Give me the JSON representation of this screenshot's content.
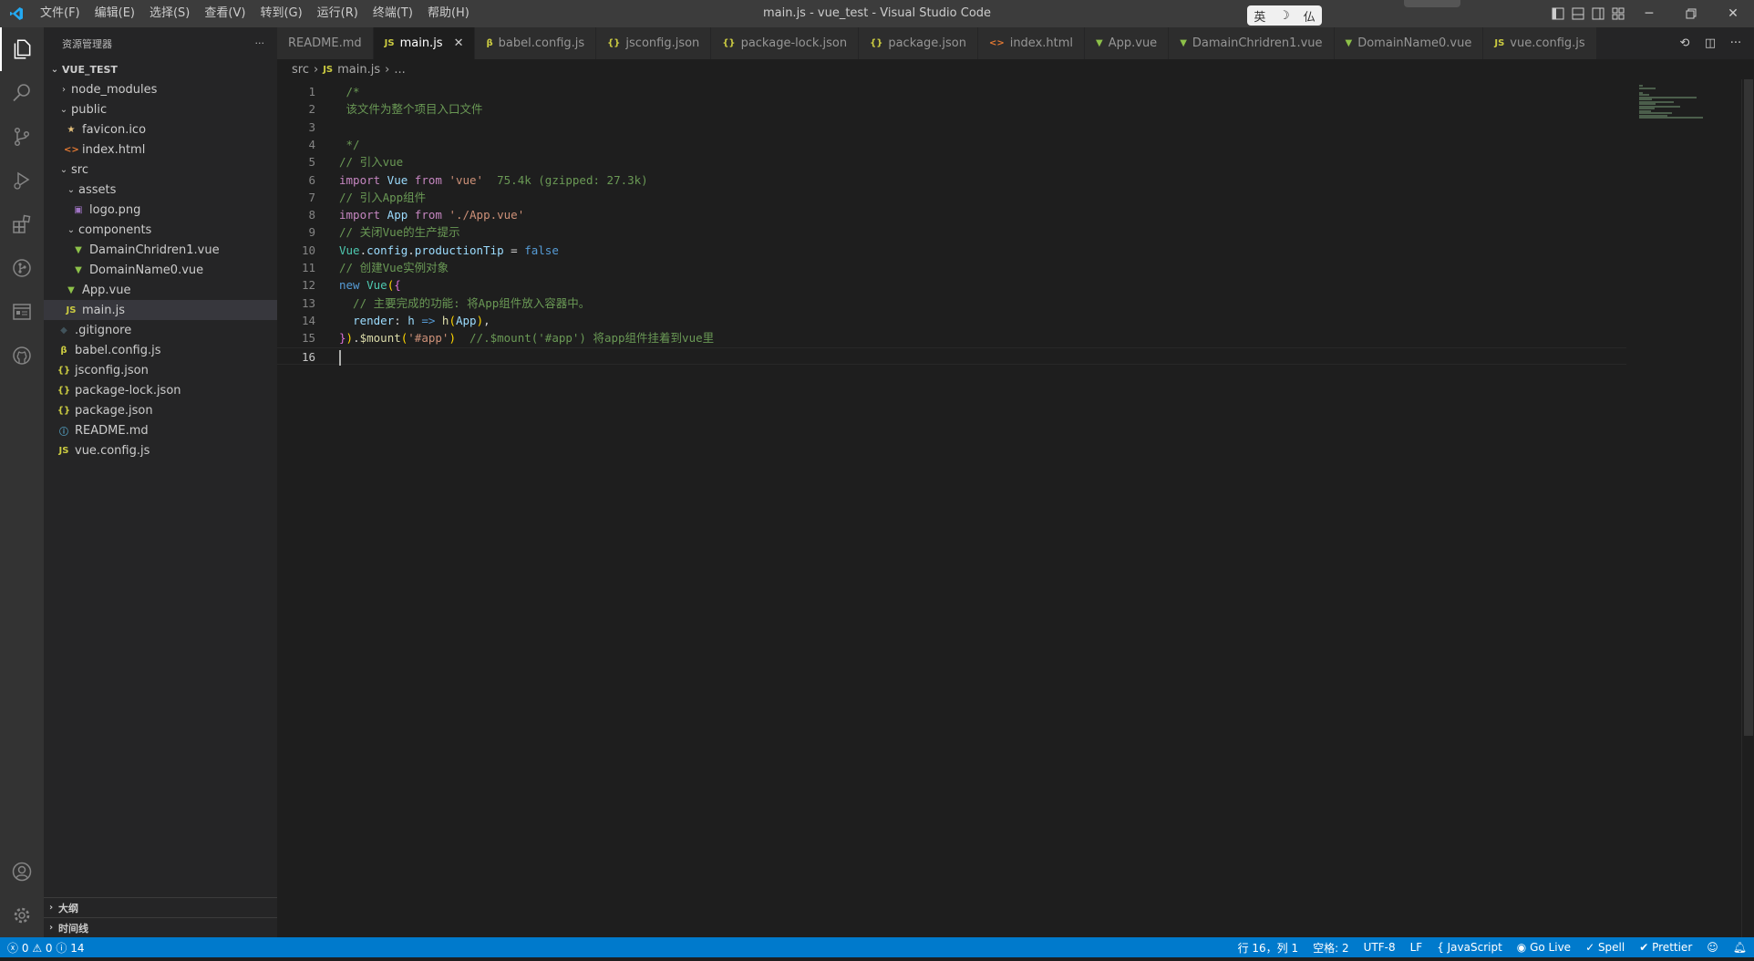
{
  "window": {
    "title": "main.js - vue_test - Visual Studio Code",
    "menu": [
      "文件(F)",
      "编辑(E)",
      "选择(S)",
      "查看(V)",
      "转到(G)",
      "运行(R)",
      "终端(T)",
      "帮助(H)"
    ],
    "ime": [
      "英",
      "☽",
      "仏"
    ]
  },
  "sidebar": {
    "title": "资源管理器",
    "more": "···",
    "root": "VUE_TEST",
    "items": [
      {
        "label": "node_modules",
        "depth": 1,
        "kind": "folder",
        "open": false
      },
      {
        "label": "public",
        "depth": 1,
        "kind": "folder",
        "open": true
      },
      {
        "label": "favicon.ico",
        "depth": 2,
        "kind": "star"
      },
      {
        "label": "index.html",
        "depth": 2,
        "kind": "html"
      },
      {
        "label": "src",
        "depth": 1,
        "kind": "folder",
        "open": true
      },
      {
        "label": "assets",
        "depth": 2,
        "kind": "folder",
        "open": true
      },
      {
        "label": "logo.png",
        "depth": 3,
        "kind": "image"
      },
      {
        "label": "components",
        "depth": 2,
        "kind": "folder",
        "open": true
      },
      {
        "label": "DamainChridren1.vue",
        "depth": 3,
        "kind": "vue"
      },
      {
        "label": "DomainName0.vue",
        "depth": 3,
        "kind": "vue"
      },
      {
        "label": "App.vue",
        "depth": 2,
        "kind": "vue"
      },
      {
        "label": "main.js",
        "depth": 2,
        "kind": "js",
        "selected": true
      },
      {
        "label": ".gitignore",
        "depth": 1,
        "kind": "git"
      },
      {
        "label": "babel.config.js",
        "depth": 1,
        "kind": "babel"
      },
      {
        "label": "jsconfig.json",
        "depth": 1,
        "kind": "json"
      },
      {
        "label": "package-lock.json",
        "depth": 1,
        "kind": "json"
      },
      {
        "label": "package.json",
        "depth": 1,
        "kind": "json"
      },
      {
        "label": "README.md",
        "depth": 1,
        "kind": "info"
      },
      {
        "label": "vue.config.js",
        "depth": 1,
        "kind": "js"
      }
    ],
    "outline": "大纲",
    "timeline": "时间线"
  },
  "tabs": [
    {
      "label": "README.md",
      "icon": "",
      "active": false
    },
    {
      "label": "main.js",
      "icon": "JS",
      "active": true
    },
    {
      "label": "babel.config.js",
      "icon": "babel",
      "active": false
    },
    {
      "label": "jsconfig.json",
      "icon": "{}",
      "active": false
    },
    {
      "label": "package-lock.json",
      "icon": "{}",
      "active": false
    },
    {
      "label": "package.json",
      "icon": "{}",
      "active": false
    },
    {
      "label": "index.html",
      "icon": "<>",
      "active": false
    },
    {
      "label": "App.vue",
      "icon": "vue",
      "active": false
    },
    {
      "label": "DamainChridren1.vue",
      "icon": "vue",
      "active": false
    },
    {
      "label": "DomainName0.vue",
      "icon": "vue",
      "active": false
    },
    {
      "label": "vue.config.js",
      "icon": "JS",
      "active": false
    }
  ],
  "breadcrumb": {
    "folder": "src",
    "file": "main.js",
    "tail": "..."
  },
  "editor": {
    "current_line": 16,
    "lines": [
      [
        {
          "t": " /*",
          "c": "c-comment"
        }
      ],
      [
        {
          "t": " 该文件为整个项目入口文件",
          "c": "c-comment"
        }
      ],
      [
        {
          "t": "",
          "c": ""
        }
      ],
      [
        {
          "t": " */",
          "c": "c-comment"
        }
      ],
      [
        {
          "t": "// 引入vue",
          "c": "c-comment"
        }
      ],
      [
        {
          "t": "import",
          "c": "c-kw"
        },
        {
          "t": " Vue ",
          "c": "c-var"
        },
        {
          "t": "from",
          "c": "c-kw"
        },
        {
          "t": " ",
          "c": ""
        },
        {
          "t": "'vue'",
          "c": "c-str"
        },
        {
          "t": "  75.4k (gzipped: 27.3k)",
          "c": "c-hint"
        }
      ],
      [
        {
          "t": "// 引入App组件",
          "c": "c-comment"
        }
      ],
      [
        {
          "t": "import",
          "c": "c-kw"
        },
        {
          "t": " App ",
          "c": "c-var"
        },
        {
          "t": "from",
          "c": "c-kw"
        },
        {
          "t": " ",
          "c": ""
        },
        {
          "t": "'./App.vue'",
          "c": "c-str"
        }
      ],
      [
        {
          "t": "// 关闭Vue的生产提示",
          "c": "c-comment"
        }
      ],
      [
        {
          "t": "Vue",
          "c": "c-cls"
        },
        {
          "t": ".",
          "c": "c-op"
        },
        {
          "t": "config",
          "c": "c-var"
        },
        {
          "t": ".",
          "c": "c-op"
        },
        {
          "t": "productionTip",
          "c": "c-var"
        },
        {
          "t": " = ",
          "c": "c-op"
        },
        {
          "t": "false",
          "c": "c-kw2"
        }
      ],
      [
        {
          "t": "// 创建Vue实例对象",
          "c": "c-comment"
        }
      ],
      [
        {
          "t": "new",
          "c": "c-kw2"
        },
        {
          "t": " ",
          "c": ""
        },
        {
          "t": "Vue",
          "c": "c-cls"
        },
        {
          "t": "(",
          "c": "c-brace2"
        },
        {
          "t": "{",
          "c": "c-brace"
        }
      ],
      [
        {
          "t": "  // 主要完成的功能: 将App组件放入容器中。",
          "c": "c-comment"
        }
      ],
      [
        {
          "t": "  ",
          "c": ""
        },
        {
          "t": "render",
          "c": "c-var"
        },
        {
          "t": ": ",
          "c": "c-op"
        },
        {
          "t": "h",
          "c": "c-var"
        },
        {
          "t": " => ",
          "c": "c-kw2"
        },
        {
          "t": "h",
          "c": "c-fn"
        },
        {
          "t": "(",
          "c": "c-brace2"
        },
        {
          "t": "App",
          "c": "c-var"
        },
        {
          "t": ")",
          "c": "c-brace2"
        },
        {
          "t": ",",
          "c": "c-op"
        }
      ],
      [
        {
          "t": "}",
          "c": "c-brace"
        },
        {
          "t": ")",
          "c": "c-brace2"
        },
        {
          "t": ".",
          "c": "c-op"
        },
        {
          "t": "$mount",
          "c": "c-fn"
        },
        {
          "t": "(",
          "c": "c-brace2"
        },
        {
          "t": "'#app'",
          "c": "c-str"
        },
        {
          "t": ")",
          "c": "c-brace2"
        },
        {
          "t": "  //.$mount('#app') 将app组件挂着到vue里",
          "c": "c-comment"
        }
      ],
      [
        {
          "t": "",
          "c": ""
        }
      ]
    ]
  },
  "status": {
    "errors": "0",
    "warnings": "0",
    "info": "14",
    "position": "行 16，列 1",
    "spaces": "空格: 2",
    "encoding": "UTF-8",
    "eol": "LF",
    "language": "JavaScript",
    "golive": "Go Live",
    "spell": "Spell",
    "prettier": "Prettier"
  },
  "colors": {
    "statusbar": "#007acc",
    "activitybar": "#333333",
    "sidebar": "#252526",
    "editor": "#1e1e1e",
    "vscode_blue": "#23a9f2"
  }
}
